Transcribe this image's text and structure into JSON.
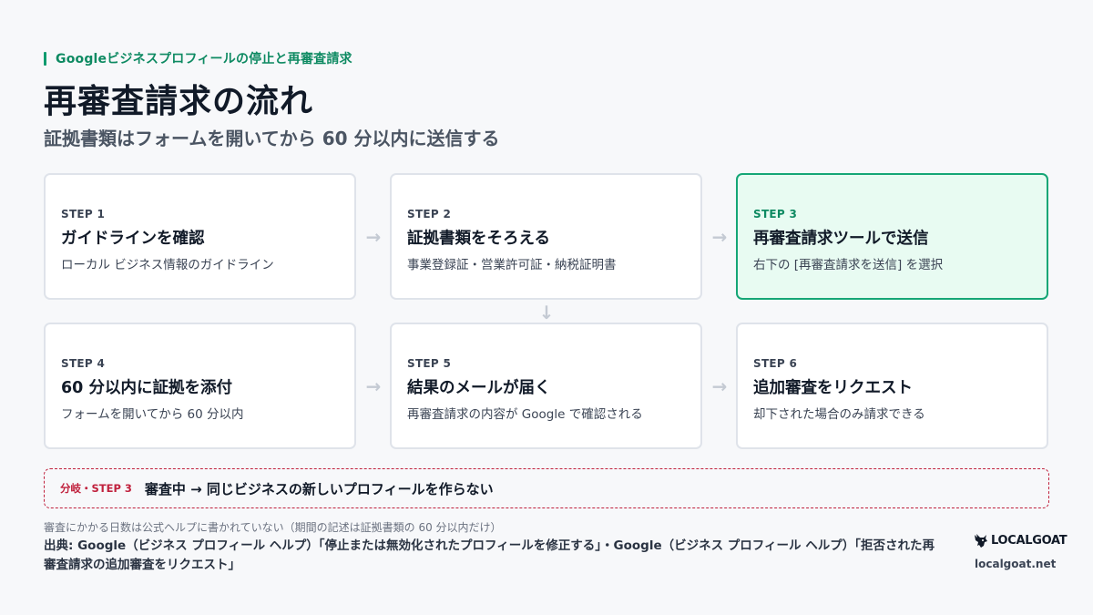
{
  "header": {
    "eyebrow": "Googleビジネスプロフィールの停止と再審査請求",
    "title": "再審査請求の流れ",
    "subtitle": "証拠書類はフォームを開いてから 60 分以内に送信する"
  },
  "steps": [
    {
      "step": "STEP 1",
      "title": "ガイドラインを確認",
      "desc": "ローカル ビジネス情報のガイドライン",
      "active": false
    },
    {
      "step": "STEP 2",
      "title": "証拠書類をそろえる",
      "desc": "事業登録証・営業許可証・納税証明書",
      "active": false
    },
    {
      "step": "STEP 3",
      "title": "再審査請求ツールで送信",
      "desc": "右下の [再審査請求を送信] を選択",
      "active": true
    },
    {
      "step": "STEP 4",
      "title": "60 分以内に証拠を添付",
      "desc": "フォームを開いてから 60 分以内",
      "active": false
    },
    {
      "step": "STEP 5",
      "title": "結果のメールが届く",
      "desc": "再審査請求の内容が Google で確認される",
      "active": false
    },
    {
      "step": "STEP 6",
      "title": "追加審査をリクエスト",
      "desc": "却下された場合のみ請求できる",
      "active": false
    }
  ],
  "arrows": {
    "right": "→",
    "down": "↓"
  },
  "branch": {
    "label": "分岐・STEP 3",
    "text": "審査中 → 同じビジネスの新しいプロフィールを作らない"
  },
  "footer": {
    "note": "審査にかかる日数は公式ヘルプに書かれていない（期間の記述は証拠書類の 60 分以内だけ）",
    "source": "出典: Google（ビジネス プロフィール ヘルプ）「停止または無効化されたプロフィールを修正する」・Google（ビジネス プロフィール ヘルプ）「拒否された再審査請求の追加審査をリクエスト」",
    "logo_text": "LOCALGOAT",
    "logo_url": "localgoat.net"
  },
  "colors": {
    "accent": "#0e9b6e",
    "active_bg": "#e8fbf2",
    "warning": "#c0213d"
  }
}
